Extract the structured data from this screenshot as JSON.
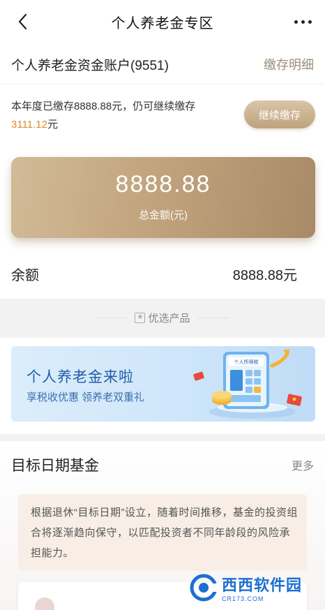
{
  "nav": {
    "title": "个人养老金专区"
  },
  "account": {
    "name": "个人养老金资金账户(9551)",
    "detail_link": "缴存明细",
    "contrib_prefix": "本年度已缴存8888.88元，仍可继续缴存",
    "contrib_remaining": "3111.12",
    "contrib_suffix": "元",
    "continue_button": "继续缴存",
    "total_amount": "8888.88",
    "total_label": "总金额(元)",
    "balance_label": "余额",
    "balance_value": "8888.88元"
  },
  "featured": {
    "title": "优选产品",
    "banner_title": "个人养老金来啦",
    "banner_subtitle": "享税收优惠 领养老双重礼",
    "banner_device_label": "个人所得税"
  },
  "fund": {
    "title": "目标日期基金",
    "more": "更多",
    "description": "根据退休“目标日期”设立，随着时间推移，基金的投资组合将逐渐趋向保守，以匹配投资者不同年龄段的风险承担能力。"
  },
  "watermark": {
    "main": "西西软件园",
    "sub": "CR173.COM"
  },
  "colors": {
    "gold_start": "#d2bb98",
    "gold_end": "#a88a68",
    "highlight": "#e08a2a",
    "banner_blue": "#1f5fa8"
  },
  "icons": {
    "back": "chevron-left-icon",
    "more": "more-dots-icon",
    "featured": "star-box-icon"
  }
}
